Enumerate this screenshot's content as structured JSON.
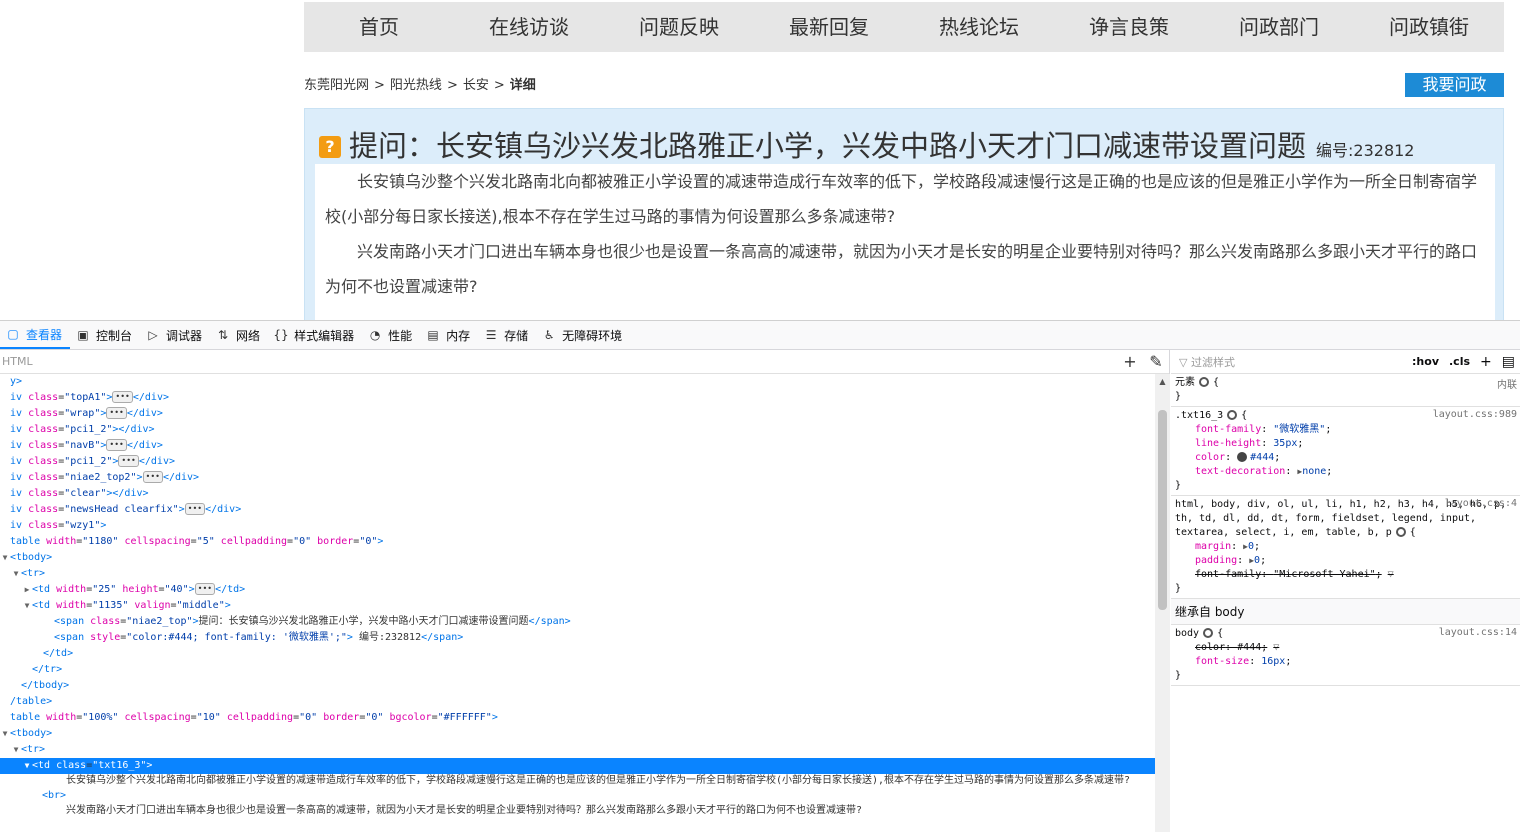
{
  "nav": {
    "items": [
      "首页",
      "在线访谈",
      "问题反映",
      "最新回复",
      "热线论坛",
      "诤言良策",
      "问政部门",
      "问政镇街"
    ]
  },
  "breadcrumb": {
    "items": [
      "东莞阳光网",
      "阳光热线",
      "长安"
    ],
    "sep": ">",
    "current": "详细"
  },
  "ask_button": "我要问政",
  "question": {
    "icon": "question-icon",
    "title": "提问：长安镇乌沙兴发北路雅正小学，兴发中路小天才门口减速带设置问题",
    "number": "编号:232812",
    "paragraphs": [
      "长安镇乌沙整个兴发北路南北向都被雅正小学设置的减速带造成行车效率的低下，学校路段减速慢行这是正确的也是应该的但是雅正小学作为一所全日制寄宿学校(小部分每日家长接送),根本不存在学生过马路的事情为何设置那么多条减速带?",
      "兴发南路小天才门口进出车辆本身也很少也是设置一条高高的减速带，就因为小天才是长安的明星企业要特别对待吗？那么兴发南路那么多跟小天才平行的路口为何不也设置减速带?"
    ]
  },
  "devtools": {
    "tabs": [
      {
        "label": "查看器",
        "icon": "inspector-icon",
        "glyph": "▢"
      },
      {
        "label": "控制台",
        "icon": "console-icon",
        "glyph": "▣"
      },
      {
        "label": "调试器",
        "icon": "debugger-icon",
        "glyph": "▷"
      },
      {
        "label": "网络",
        "icon": "network-icon",
        "glyph": "⇅"
      },
      {
        "label": "样式编辑器",
        "icon": "style-editor-icon",
        "glyph": "{}"
      },
      {
        "label": "性能",
        "icon": "performance-icon",
        "glyph": "◔"
      },
      {
        "label": "内存",
        "icon": "memory-icon",
        "glyph": "▤"
      },
      {
        "label": "存储",
        "icon": "storage-icon",
        "glyph": "☰"
      },
      {
        "label": "无障碍环境",
        "icon": "accessibility-icon",
        "glyph": "♿"
      }
    ],
    "markup_search_placeholder": "HTML",
    "markup_lines": [
      {
        "indent": 0,
        "tw": "",
        "html": "<span class='tag'>y&gt;</span>"
      },
      {
        "indent": 0,
        "tw": "",
        "html": "<span class='tag'>iv</span> <span class='an'>class</span>=<span class='av'>\"topA1\"</span><span class='tag'>&gt;</span><span class='dots'>•••</span><span class='tag'>&lt;/div&gt;</span>"
      },
      {
        "indent": 0,
        "tw": "",
        "html": "<span class='tag'>iv</span> <span class='an'>class</span>=<span class='av'>\"wrap\"</span><span class='tag'>&gt;</span><span class='dots'>•••</span><span class='tag'>&lt;/div&gt;</span>"
      },
      {
        "indent": 0,
        "tw": "",
        "html": "<span class='tag'>iv</span> <span class='an'>class</span>=<span class='av'>\"pci1_2\"</span><span class='tag'>&gt;&lt;/div&gt;</span>"
      },
      {
        "indent": 0,
        "tw": "",
        "html": "<span class='tag'>iv</span> <span class='an'>class</span>=<span class='av'>\"navB\"</span><span class='tag'>&gt;</span><span class='dots'>•••</span><span class='tag'>&lt;/div&gt;</span>"
      },
      {
        "indent": 0,
        "tw": "",
        "html": "<span class='tag'>iv</span> <span class='an'>class</span>=<span class='av'>\"pci1_2\"</span><span class='tag'>&gt;</span><span class='dots'>•••</span><span class='tag'>&lt;/div&gt;</span>"
      },
      {
        "indent": 0,
        "tw": "",
        "html": "<span class='tag'>iv</span> <span class='an'>class</span>=<span class='av'>\"niae2_top2\"</span><span class='tag'>&gt;</span><span class='dots'>•••</span><span class='tag'>&lt;/div&gt;</span>"
      },
      {
        "indent": 0,
        "tw": "",
        "html": "<span class='tag'>iv</span> <span class='an'>class</span>=<span class='av'>\"clear\"</span><span class='tag'>&gt;&lt;/div&gt;</span>"
      },
      {
        "indent": 0,
        "tw": "",
        "html": "<span class='tag'>iv</span> <span class='an'>class</span>=<span class='av'>\"newsHead clearfix\"</span><span class='tag'>&gt;</span><span class='dots'>•••</span><span class='tag'>&lt;/div&gt;</span>"
      },
      {
        "indent": 0,
        "tw": "",
        "html": "<span class='tag'>iv</span> <span class='an'>class</span>=<span class='av'>\"wzy1\"</span><span class='tag'>&gt;</span>"
      },
      {
        "indent": 0,
        "tw": "",
        "html": "<span class='tag'>table</span> <span class='an'>width</span>=<span class='av'>\"1180\"</span> <span class='an'>cellspacing</span>=<span class='av'>\"5\"</span> <span class='an'>cellpadding</span>=<span class='av'>\"0\"</span> <span class='an'>border</span>=<span class='av'>\"0\"</span><span class='tag'>&gt;</span>"
      },
      {
        "indent": 0,
        "tw": "▼",
        "html": "<span class='tag'>&lt;tbody&gt;</span>"
      },
      {
        "indent": 1,
        "tw": "▼",
        "html": "<span class='tag'>&lt;tr&gt;</span>"
      },
      {
        "indent": 2,
        "tw": "▶",
        "html": "<span class='tag'>&lt;td</span> <span class='an'>width</span>=<span class='av'>\"25\"</span> <span class='an'>height</span>=<span class='av'>\"40\"</span><span class='tag'>&gt;</span><span class='dots'>•••</span><span class='tag'>&lt;/td&gt;</span>"
      },
      {
        "indent": 2,
        "tw": "▼",
        "html": "<span class='tag'>&lt;td</span> <span class='an'>width</span>=<span class='av'>\"1135\"</span> <span class='an'>valign</span>=<span class='av'>\"middle\"</span><span class='tag'>&gt;</span>"
      },
      {
        "indent": 4,
        "tw": "",
        "html": "<span class='tag'>&lt;span</span> <span class='an'>class</span>=<span class='av'>\"niae2_top\"</span><span class='tag'>&gt;</span><span class='tx'>提问：长安镇乌沙兴发北路雅正小学，兴发中路小天才门口减速带设置问题</span><span class='tag'>&lt;/span&gt;</span>"
      },
      {
        "indent": 4,
        "tw": "",
        "html": "<span class='tag'>&lt;span</span> <span class='an'>style</span>=<span class='av'>\"color:#444; font-family: '微软雅黑';\"</span><span class='tag'>&gt;</span><span class='tx'>  编号:232812</span><span class='tag'>&lt;/span&gt;</span>"
      },
      {
        "indent": 3,
        "tw": "",
        "html": "<span class='tag'>&lt;/td&gt;</span>"
      },
      {
        "indent": 2,
        "tw": "",
        "html": "<span class='tag'>&lt;/tr&gt;</span>"
      },
      {
        "indent": 1,
        "tw": "",
        "html": "<span class='tag'>&lt;/tbody&gt;</span>"
      },
      {
        "indent": 0,
        "tw": "",
        "html": "<span class='tag'>/table&gt;</span>"
      },
      {
        "indent": 0,
        "tw": "",
        "html": "<span class='tag'>table</span> <span class='an'>width</span>=<span class='av'>\"100%\"</span> <span class='an'>cellspacing</span>=<span class='av'>\"10\"</span> <span class='an'>cellpadding</span>=<span class='av'>\"0\"</span> <span class='an'>border</span>=<span class='av'>\"0\"</span> <span class='an'>bgcolor</span>=<span class='av'>\"#FFFFFF\"</span><span class='tag'>&gt;</span>"
      },
      {
        "indent": 0,
        "tw": "▼",
        "html": "<span class='tag'>&lt;tbody&gt;</span>"
      },
      {
        "indent": 1,
        "tw": "▼",
        "html": "<span class='tag'>&lt;tr&gt;</span>"
      },
      {
        "indent": 2,
        "tw": "▼",
        "sel": true,
        "html": "<span class='tag'>&lt;td</span> <span class='an'>class</span>=<span class='av'>\"txt16_3\"</span><span class='tag'>&gt;</span>"
      }
    ],
    "markup_text_1": "长安镇乌沙整个兴发北路南北向都被雅正小学设置的减速带造成行车效率的低下，学校路段减速慢行这是正确的也是应该的但是雅正小学作为一所全日制寄宿学校(小部分每日家长接送),根本不存在学生过马路的事情为何设置那么多条减速带?",
    "markup_br": "<br>",
    "markup_text_2": "兴发南路小天才门口进出车辆本身也很少也是设置一条高高的减速带，就因为小天才是长安的明星企业要特别对待吗？那么兴发南路那么多跟小天才平行的路口为何不也设置减速带?",
    "rules_filter_placeholder": "过滤样式",
    "rules_hov": ":hov",
    "rules_cls": ".cls",
    "element_rule": {
      "selector": "元素",
      "source": "内联"
    },
    "txt_rule": {
      "selector": ".txt16_3",
      "source": "layout.css:989",
      "props": [
        {
          "name": "font-family",
          "value": "\"微软雅黑\""
        },
        {
          "name": "line-height",
          "value": "35px"
        },
        {
          "name": "color",
          "value": "#444"
        },
        {
          "name": "text-decoration",
          "value": "none"
        }
      ]
    },
    "reset_rule": {
      "selector": "html, body, div, ol, ul, li, h1, h2, h3, h4, h5, h6, p, th, td, dl, dd, dt, form, fieldset, legend, input, textarea, select, i, em, table, b, p",
      "source": "layout.css:4",
      "props": [
        {
          "name": "margin",
          "value": "0"
        },
        {
          "name": "padding",
          "value": "0"
        },
        {
          "name": "font-family",
          "value": "\"Microsoft Yahei\""
        }
      ]
    },
    "inherited_label": "继承自 body",
    "body_rule": {
      "selector": "body",
      "source": "layout.css:14",
      "props": [
        {
          "name": "color",
          "value": "#444"
        },
        {
          "name": "font-size",
          "value": "16px"
        }
      ]
    }
  },
  "colors": {
    "accent": "#0a84ff",
    "ask_button": "#1d8bd6",
    "question_box": "#dcedfa"
  }
}
